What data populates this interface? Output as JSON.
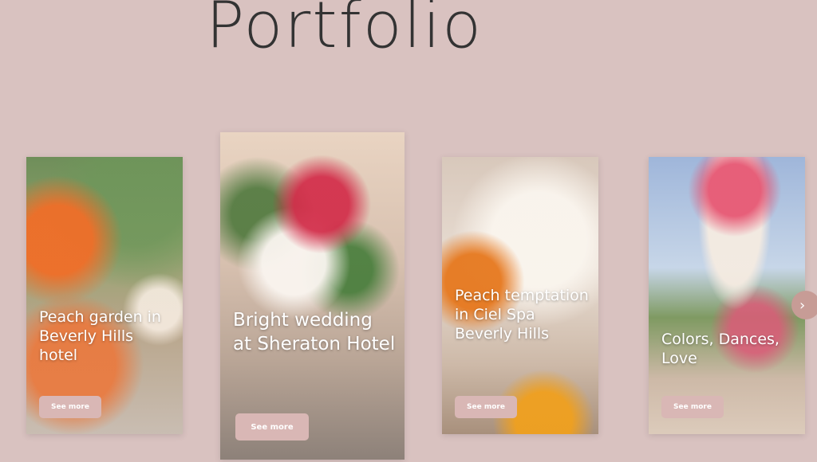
{
  "page": {
    "title": "Portfolio"
  },
  "colors": {
    "background": "#d9c2c0",
    "title_text": "#333333",
    "button_bg": "#d9b7b5",
    "button_text": "#ffffff",
    "arrow_bg": "#c79c96"
  },
  "portfolio": {
    "cards": [
      {
        "title": "Peach garden in Beverly Hills hotel",
        "button_label": "See more"
      },
      {
        "title": "Bright wedding at Sheraton Hotel",
        "button_label": "See more"
      },
      {
        "title": "Peach temptation in Ciel Spa Beverly Hills",
        "button_label": "See more"
      },
      {
        "title": "Colors, Dances, Love",
        "button_label": "See more"
      }
    ]
  },
  "carousel": {
    "next_icon": "chevron-right-icon",
    "next_glyph": "›"
  }
}
